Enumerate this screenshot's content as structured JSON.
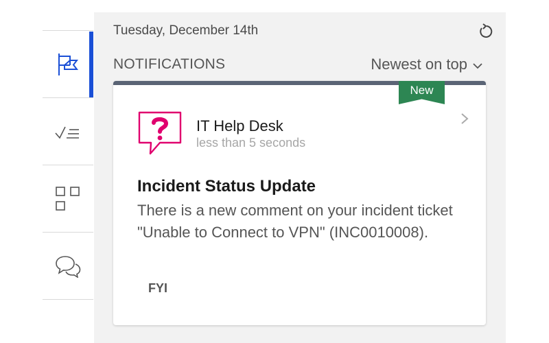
{
  "nav": {
    "items": [
      {
        "name": "flag",
        "active": true
      },
      {
        "name": "tasks",
        "active": false
      },
      {
        "name": "apps",
        "active": false
      },
      {
        "name": "chat",
        "active": false
      }
    ],
    "accent_color": "#1a4fd6"
  },
  "header": {
    "date": "Tuesday, December 14th",
    "refresh_icon": "refresh-icon"
  },
  "notifications": {
    "section_title": "NOTIFICATIONS",
    "sort_label": "Newest on top",
    "items": [
      {
        "badge": "New",
        "badge_color": "#2d8653",
        "source": "IT Help Desk",
        "time": "less than 5 seconds",
        "source_icon": "help-question-icon",
        "icon_color": "#e0006e",
        "title": "Incident Status Update",
        "body": "There is a new comment on your incident ticket \"Unable to Connect to VPN\" (INC0010008).",
        "tag": "FYI"
      }
    ]
  }
}
